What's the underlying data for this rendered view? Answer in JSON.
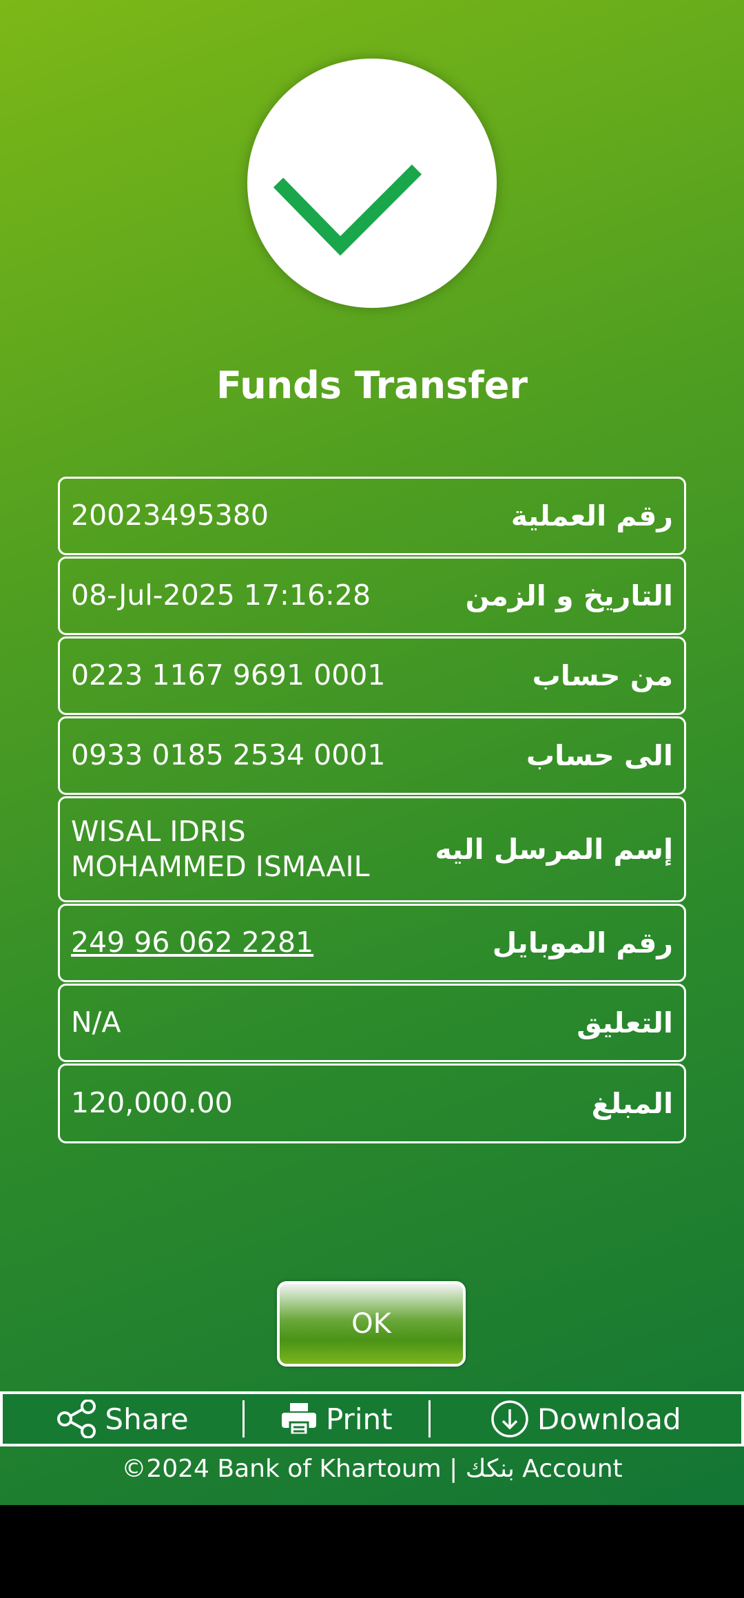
{
  "title": "Funds Transfer",
  "details": [
    {
      "label": "رقم العملية",
      "value": "20023495380"
    },
    {
      "label": "التاريخ و الزمن",
      "value": "08-Jul-2025 17:16:28"
    },
    {
      "label": "من حساب",
      "value": "0223 1167 9691 0001"
    },
    {
      "label": "الى حساب",
      "value": "0933 0185 2534 0001"
    },
    {
      "label": "إسم المرسل اليه",
      "value_line1": "WISAL IDRIS",
      "value_line2": "MOHAMMED ISMAAIL"
    },
    {
      "label": "رقم الموبايل",
      "value": "249 96 062 2281"
    },
    {
      "label": "التعليق",
      "value": "N/A"
    },
    {
      "label": "المبلغ",
      "value": "120,000.00"
    }
  ],
  "ok_label": "OK",
  "actions": {
    "share": "Share",
    "print": "Print",
    "download": "Download"
  },
  "footer": "©2024 Bank of Khartoum | بنكك Account",
  "icons": {
    "success": "checkmark-icon",
    "share": "share-icon",
    "print": "printer-icon",
    "download": "download-icon"
  },
  "colors": {
    "check": "#1aa64b",
    "gradient_start": "#7cb817",
    "gradient_end": "#137534"
  }
}
